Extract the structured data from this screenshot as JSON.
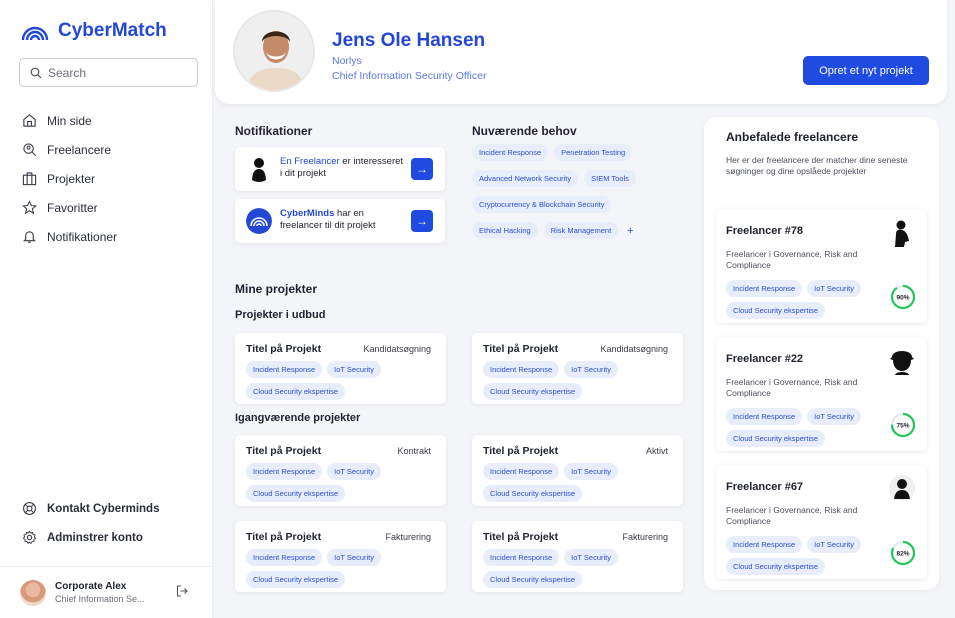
{
  "app": {
    "name": "CyberMatch"
  },
  "search": {
    "placeholder": "Search"
  },
  "sidebar": {
    "items": [
      {
        "label": "Min side",
        "icon": "home-icon"
      },
      {
        "label": "Freelancere",
        "icon": "search-person-icon"
      },
      {
        "label": "Projekter",
        "icon": "briefcase-icon"
      },
      {
        "label": "Favoritter",
        "icon": "star-icon"
      },
      {
        "label": "Notifikationer",
        "icon": "bell-icon"
      }
    ],
    "bottom_items": [
      {
        "label": "Kontakt Cyberminds",
        "icon": "support-icon"
      },
      {
        "label": "Adminstrer konto",
        "icon": "gear-icon"
      }
    ],
    "user": {
      "name": "Corporate Alex",
      "role": "Chief Information Se..."
    }
  },
  "profile": {
    "name": "Jens Ole Hansen",
    "company": "Norlys",
    "title": "Chief Information Security Officer",
    "new_project_label": "Opret et nyt projekt"
  },
  "notifications": {
    "title": "Notifikationer",
    "items": [
      {
        "link": "En Freelancer",
        "text": " er interesseret i dit projekt"
      },
      {
        "link": "CyberMinds",
        "text": " har en freelancer til dit projekt"
      }
    ]
  },
  "needs": {
    "title": "Nuværende behov",
    "tags": [
      "Incident Response",
      "Penetration Testing",
      "Advanced Network Security",
      "SIEM Tools",
      "Cryptocurrency & Blockchain Security",
      "Ethical Hacking",
      "Risk Management"
    ],
    "more": "+"
  },
  "projects": {
    "title": "Mine projekter",
    "tender_title": "Projekter i udbud",
    "active_title": "Igangværende projekter",
    "tags": [
      "Incident Response",
      "IoT Security",
      "Cloud Security ekspertise"
    ],
    "tender": [
      {
        "title": "Titel på Projekt",
        "status": "Kandidatsøgning"
      },
      {
        "title": "Titel på Projekt",
        "status": "Kandidatsøgning"
      }
    ],
    "active": [
      {
        "title": "Titel på Projekt",
        "status": "Kontrakt"
      },
      {
        "title": "Titel på Projekt",
        "status": "Aktivt"
      },
      {
        "title": "Titel på Projekt",
        "status": "Fakturering"
      },
      {
        "title": "Titel på Projekt",
        "status": "Fakturering"
      }
    ]
  },
  "recommended": {
    "title": "Anbefalede freelancere",
    "description": "Her er der freelancere der matcher dine seneste søgninger og dine opslåede projekter",
    "freelancers": [
      {
        "name": "Freelancer #78",
        "description": "Freelancer i Governance, Risk and Compliance",
        "match": 90,
        "match_label": "90%"
      },
      {
        "name": "Freelancer #22",
        "description": "Freelancer i Governance, Risk and Compliance",
        "match": 75,
        "match_label": "75%"
      },
      {
        "name": "Freelancer #67",
        "description": "Freelancer i Governance, Risk and Compliance",
        "match": 82,
        "match_label": "82%"
      }
    ]
  },
  "colors": {
    "accent": "#1f4be0",
    "tag_bg": "#e8edfb",
    "match_ring": "#22c55e"
  }
}
